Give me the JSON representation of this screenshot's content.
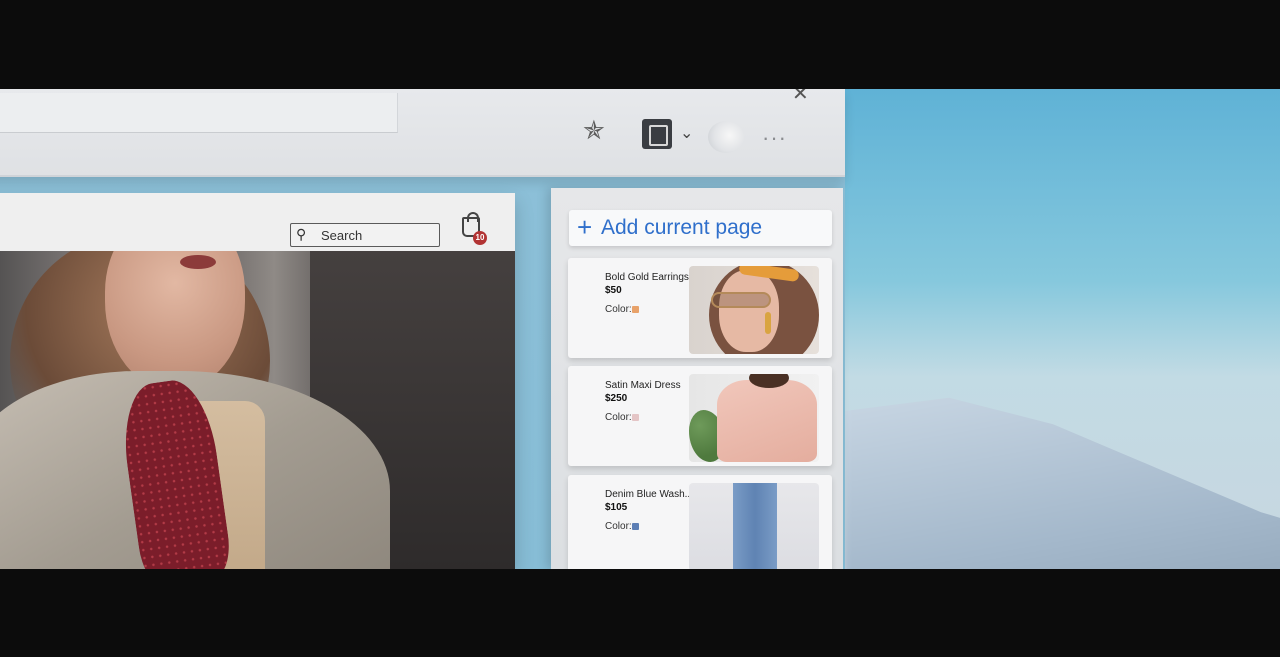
{
  "toolbar": {
    "icons": [
      "favorites-star-icon",
      "collections-icon",
      "chevron-down-icon",
      "profile-icon",
      "more-icon"
    ],
    "more_glyph": "···",
    "close_glyph": "✕"
  },
  "site": {
    "search_placeholder": "Search",
    "bag_count": "10"
  },
  "collections_panel": {
    "add_label": "Add current page",
    "items": [
      {
        "name": "Bold Gold Earrings",
        "price": "$50",
        "color_label": "Color:",
        "swatch": "#e8a26a"
      },
      {
        "name": "Satin Maxi Dress",
        "price": "$250",
        "color_label": "Color:",
        "swatch": "#e4c5c6"
      },
      {
        "name": "Denim Blue Wash..",
        "price": "$105",
        "color_label": "Color:",
        "swatch": "#5d7fb5"
      }
    ]
  },
  "colors": {
    "accent": "#2f6fcb",
    "badge": "#b23434"
  }
}
